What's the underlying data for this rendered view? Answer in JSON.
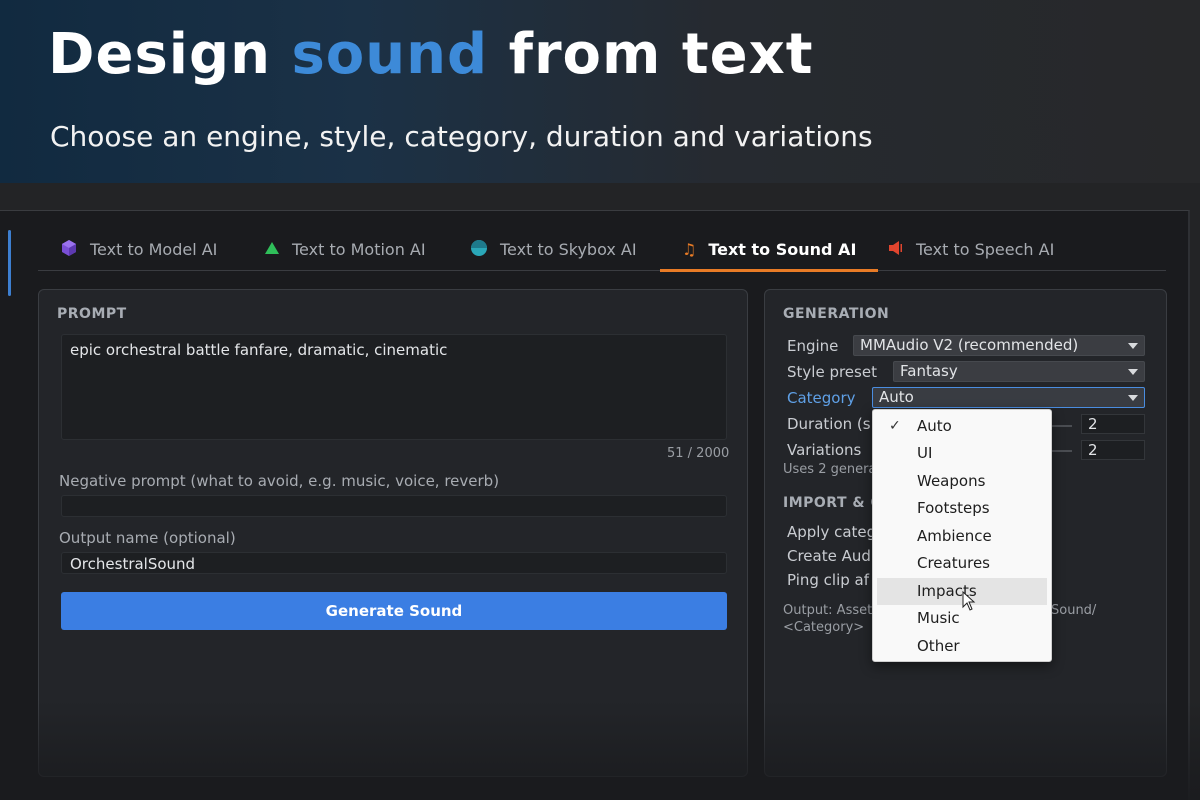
{
  "banner": {
    "title_part1": "Design",
    "title_accent": "sound",
    "title_part2": "from text",
    "subtitle": "Choose an engine, style, category, duration and variations"
  },
  "tabs": [
    {
      "label": "Text to Model AI",
      "icon": "cube-icon",
      "color": "#7a4fd6"
    },
    {
      "label": "Text to Motion AI",
      "icon": "triangle-icon",
      "color": "#2fbf5a"
    },
    {
      "label": "Text to Skybox AI",
      "icon": "sphere-icon",
      "color": "#2aa7b8"
    },
    {
      "label": "Text to Sound AI",
      "icon": "music-note-icon",
      "color": "#e87b26",
      "active": true
    },
    {
      "label": "Text to Speech AI",
      "icon": "speaker-icon",
      "color": "#e0452e"
    }
  ],
  "left": {
    "prompt_heading": "PROMPT",
    "prompt_text": "epic orchestral battle fanfare, dramatic, cinematic",
    "counter": "51 / 2000",
    "negative_label": "Negative prompt (what to avoid, e.g. music, voice, reverb)",
    "negative_value": "",
    "output_label": "Output name (optional)",
    "output_value": "OrchestralSound",
    "generate_label": "Generate Sound"
  },
  "right": {
    "generation_heading": "GENERATION",
    "engine_label": "Engine",
    "engine_value": "MMAudio V2 (recommended)",
    "style_label": "Style preset",
    "style_value": "Fantasy",
    "category_label": "Category",
    "category_value": "Auto",
    "duration_label": "Duration (s",
    "duration_value": "2",
    "variations_label": "Variations",
    "variations_value": "2",
    "uses_text": "Uses 2 genera",
    "import_heading": "IMPORT & O",
    "apply_label": "Apply categ",
    "create_label": "Create Aud",
    "ping_label": "Ping clip af",
    "output_line1_start": "Output: Asset",
    "output_line1_end": "Sound/",
    "output_line2": "<Category>"
  },
  "dropdown": {
    "items": [
      "Auto",
      "UI",
      "Weapons",
      "Footsteps",
      "Ambience",
      "Creatures",
      "Impacts",
      "Music",
      "Other"
    ],
    "checked": "Auto",
    "hovered": "Impacts"
  },
  "colors": {
    "accent_blue": "#3d8ad8",
    "button_blue": "#3b7ee3",
    "tab_underline": "#e87b26"
  }
}
